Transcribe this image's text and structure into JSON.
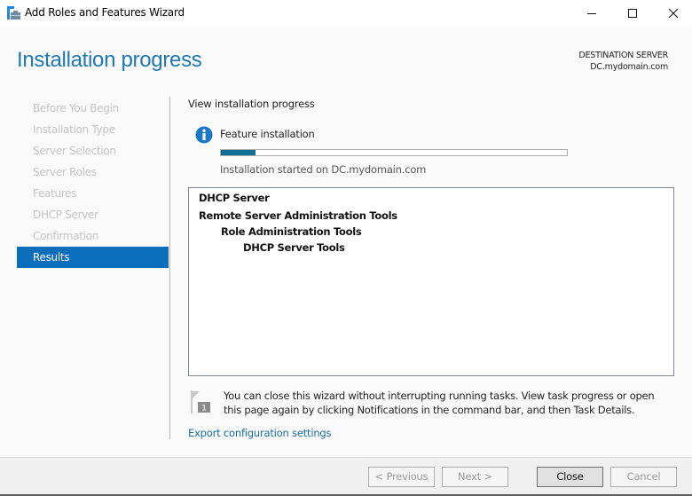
{
  "window": {
    "title": "Add Roles and Features Wizard",
    "icon": "server-manager-icon",
    "controls": [
      "minimize-icon",
      "maximize-icon",
      "close-icon"
    ]
  },
  "header": {
    "page_title": "Installation progress",
    "destination_label": "DESTINATION SERVER",
    "destination_server": "DC.mydomain.com"
  },
  "nav": {
    "items": [
      {
        "label": "Before You Begin",
        "state": "disabled"
      },
      {
        "label": "Installation Type",
        "state": "disabled"
      },
      {
        "label": "Server Selection",
        "state": "disabled"
      },
      {
        "label": "Server Roles",
        "state": "disabled"
      },
      {
        "label": "Features",
        "state": "disabled"
      },
      {
        "label": "DHCP Server",
        "state": "disabled"
      },
      {
        "label": "Confirmation",
        "state": "disabled"
      },
      {
        "label": "Results",
        "state": "active"
      }
    ]
  },
  "main": {
    "section_label": "View installation progress",
    "status_icon": "info-icon",
    "feature_label": "Feature installation",
    "progress_fraction": 0.1,
    "progress_color": "#0f6e96",
    "status_text": "Installation started on DC.mydomain.com",
    "results": [
      {
        "text": "DHCP Server",
        "level": 0
      },
      {
        "text": "Remote Server Administration Tools",
        "level": 0
      },
      {
        "text": "Role Administration Tools",
        "level": 1
      },
      {
        "text": "DHCP Server Tools",
        "level": 2
      }
    ],
    "notice_icon": "notification-flag-icon",
    "notice_badge": "1",
    "notice_text": "You can close this wizard without interrupting running tasks. View task progress or open this page again by clicking Notifications in the command bar, and then Task Details.",
    "export_link": "Export configuration settings"
  },
  "footer": {
    "previous_label": "< Previous",
    "next_label": "Next >",
    "close_label": "Close",
    "cancel_label": "Cancel"
  },
  "colors": {
    "accent": "#0a6ebd",
    "title": "#1e78b4",
    "link": "#1a6aa3"
  }
}
